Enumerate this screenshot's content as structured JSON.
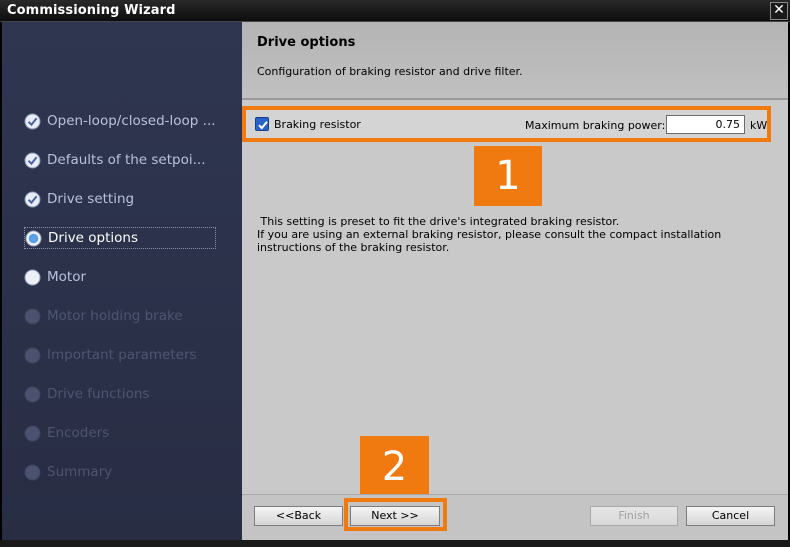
{
  "window": {
    "title": "Commissioning Wizard",
    "close_glyph": "✕"
  },
  "steps": [
    {
      "label": "Open-loop/closed-loop ...",
      "state": "done"
    },
    {
      "label": "Defaults of the setpoi...",
      "state": "done"
    },
    {
      "label": "Drive setting",
      "state": "done"
    },
    {
      "label": "Drive options",
      "state": "current"
    },
    {
      "label": "Motor",
      "state": "pending"
    },
    {
      "label": "Motor holding brake",
      "state": "disabled"
    },
    {
      "label": "Important parameters",
      "state": "disabled"
    },
    {
      "label": "Drive functions",
      "state": "disabled"
    },
    {
      "label": "Encoders",
      "state": "disabled"
    },
    {
      "label": "Summary",
      "state": "disabled"
    }
  ],
  "page": {
    "title": "Drive options",
    "subtitle": "Configuration of braking resistor and drive filter."
  },
  "braking": {
    "checkbox_label": "Braking resistor",
    "checked": true,
    "power_label": "Maximum braking power:",
    "power_value": "0.75",
    "power_unit": "kW"
  },
  "callouts": {
    "one": "1",
    "two": "2"
  },
  "info": {
    "line1": " This setting is preset to fit the drive's integrated braking resistor.",
    "line2": "If you are using an external braking resistor, please consult the compact installation",
    "line3": "instructions of the braking resistor."
  },
  "buttons": {
    "back": "<<Back",
    "next": "Next >>",
    "finish": "Finish",
    "cancel": "Cancel"
  },
  "colors": {
    "sidebar_bg": "#2c334b",
    "accent": "#f07a10",
    "done_check": "#6f84b8",
    "current_dot": "#5aa0e8"
  }
}
